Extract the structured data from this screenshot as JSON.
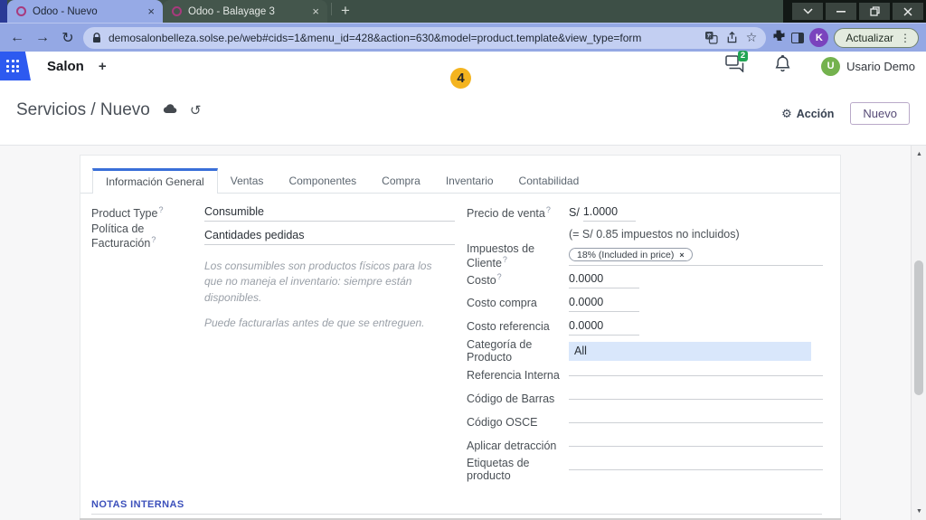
{
  "glyphs": {
    "close": "×",
    "plus": "+",
    "back": "←",
    "forward": "→",
    "reload": "↻",
    "star": "☆",
    "dots_vertical": "⋮",
    "gear": "⚙",
    "undo": "↺",
    "arrow_up": "▲",
    "arrow_down": "▼"
  },
  "browser": {
    "tabs": [
      {
        "title": "Odoo - Nuevo"
      },
      {
        "title": "Odoo - Balayage 3"
      }
    ],
    "url": "demosalonbelleza.solse.pe/web#cids=1&menu_id=428&action=630&model=product.template&view_type=form",
    "profile_initial": "K",
    "update_label": "Actualizar"
  },
  "annotation": {
    "badge": "4"
  },
  "nav": {
    "app_name": "Salon",
    "add_label": "+",
    "message_count": "2",
    "user_initial": "U",
    "user_name": "Usario Demo"
  },
  "control_panel": {
    "breadcrumb": "Servicios / Nuevo",
    "action_label": "Acción",
    "new_button": "Nuevo"
  },
  "form": {
    "help_marker": "?",
    "tabs": [
      {
        "label": "Información General"
      },
      {
        "label": "Ventas"
      },
      {
        "label": "Componentes"
      },
      {
        "label": "Compra"
      },
      {
        "label": "Inventario"
      },
      {
        "label": "Contabilidad"
      }
    ],
    "product_type": {
      "label": "Product Type",
      "value": "Consumible"
    },
    "invoice_policy": {
      "label": "Política de Facturación",
      "value": "Cantidades pedidas"
    },
    "help_text": {
      "p1": "Los consumibles son productos físicos para los que no maneja el inventario: siempre están disponibles.",
      "p2": "Puede facturarlas antes de que se entreguen."
    },
    "price": {
      "label": "Precio de venta",
      "currency": "S/",
      "value": "1.0000",
      "note": "(= S/ 0.85 impuestos no incluidos)"
    },
    "taxes": {
      "label": "Impuestos de Cliente",
      "tag": "18% (Included in price)"
    },
    "cost": {
      "label": "Costo",
      "value": "0.0000"
    },
    "cost_purchase": {
      "label": "Costo compra",
      "value": "0.0000"
    },
    "cost_reference": {
      "label": "Costo referencia",
      "value": "0.0000"
    },
    "category": {
      "label": "Categoría de Producto",
      "value": "All"
    },
    "empty_fields": [
      {
        "label": "Referencia Interna"
      },
      {
        "label": "Código de Barras"
      },
      {
        "label": "Código OSCE"
      },
      {
        "label": "Aplicar detracción"
      },
      {
        "label": "Etiquetas de producto"
      }
    ],
    "section_title": "NOTAS INTERNAS"
  }
}
